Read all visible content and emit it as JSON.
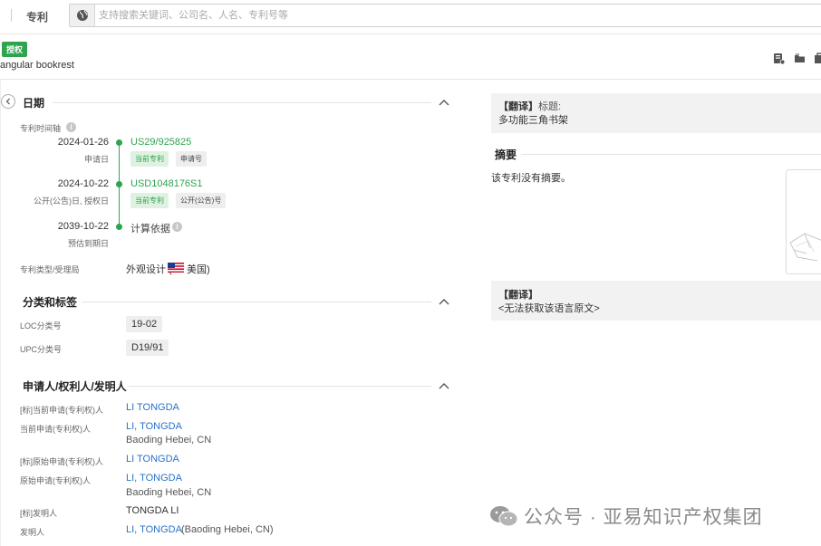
{
  "search": {
    "category": "专利",
    "placeholder": "支持搜索关键词、公司名、人名、专利号等"
  },
  "header": {
    "status_badge": "授权",
    "patent_title": "angular bookrest"
  },
  "dates_section": {
    "title": "日期",
    "timeline_label": "专利时间轴",
    "events": [
      {
        "date": "2024-01-26",
        "date_label": "申请日",
        "number": "US29/925825",
        "tags": [
          "当前专利",
          "申请号"
        ]
      },
      {
        "date": "2024-10-22",
        "date_label": "公开(公告)日, 授权日",
        "number": "USD1048176S1",
        "tags": [
          "当前专利",
          "公开(公告)号"
        ]
      },
      {
        "date": "2039-10-22",
        "date_label": "预估到期日",
        "number": "计算依据",
        "tags": []
      }
    ],
    "type_label": "专利类型/受理局",
    "type_value": "外观设计 (",
    "type_country": "美国)"
  },
  "classification": {
    "title": "分类和标签",
    "rows": [
      {
        "label": "LOC分类号",
        "value": "19-02"
      },
      {
        "label": "UPC分类号",
        "value": "D19/91"
      }
    ]
  },
  "parties": {
    "title": "申请人/权利人/发明人",
    "rows": [
      {
        "label": "[标]当前申请(专利权)人",
        "name": "LI TONGDA",
        "location": ""
      },
      {
        "label": "当前申请(专利权)人",
        "name": "LI, TONGDA",
        "location": "Baoding Hebei, CN"
      },
      {
        "label": "[标]原始申请(专利权)人",
        "name": "LI TONGDA",
        "location": ""
      },
      {
        "label": "原始申请(专利权)人",
        "name": "LI, TONGDA",
        "location": "Baoding Hebei, CN"
      },
      {
        "label": "[标]发明人",
        "name": "TONGDA LI",
        "location": ""
      },
      {
        "label": "发明人",
        "name": "LI, TONGDA",
        "location": "(Baoding Hebei, CN)"
      }
    ]
  },
  "right_panel": {
    "translate_title_label": "【翻译】",
    "translate_title_key": "标题:",
    "translate_title_value": "多功能三角书架",
    "abstract_title": "摘要",
    "abstract_text": "该专利没有摘要。",
    "translate2_label": "【翻译】",
    "translate2_text": "<无法获取该语言原文>"
  },
  "watermark": {
    "text": "公众号 · 亚易知识产权集团"
  },
  "colors": {
    "accent_green": "#2ea44f",
    "link_blue": "#2a72c8"
  },
  "icons": [
    "globe-icon",
    "chevron-left-icon",
    "chevron-up-icon",
    "info-icon",
    "us-flag-icon",
    "add-note-icon",
    "folder-icon",
    "copy-icon",
    "wechat-icon"
  ]
}
